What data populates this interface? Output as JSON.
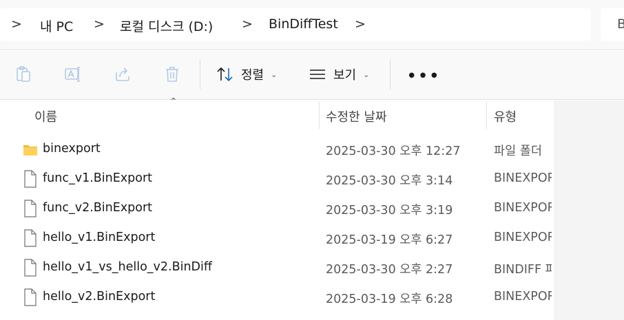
{
  "address_bar": {
    "crumbs": [
      "내 PC",
      "로컬 디스크 (D:)",
      "BinDiffTest"
    ],
    "separator": ">",
    "search_partial": "B"
  },
  "toolbar": {
    "actions": [
      {
        "name": "paste",
        "icon": "clipboard-icon"
      },
      {
        "name": "rename",
        "icon": "rename-icon"
      },
      {
        "name": "share",
        "icon": "share-icon"
      },
      {
        "name": "delete",
        "icon": "trash-icon"
      }
    ],
    "sort_label": "정렬",
    "view_label": "보기",
    "more_label": "•••"
  },
  "columns": {
    "name": "이름",
    "modified": "수정한 날짜",
    "type": "유형"
  },
  "files": [
    {
      "name": "binexport",
      "modified": "2025-03-30 오후 12:27",
      "type": "파일 폴더",
      "icon": "folder-icon"
    },
    {
      "name": "func_v1.BinExport",
      "modified": "2025-03-30 오후 3:14",
      "type": "BINEXPORT",
      "icon": "file-icon"
    },
    {
      "name": "func_v2.BinExport",
      "modified": "2025-03-30 오후 3:19",
      "type": "BINEXPORT",
      "icon": "file-icon"
    },
    {
      "name": "hello_v1.BinExport",
      "modified": "2025-03-19 오후 6:27",
      "type": "BINEXPORT",
      "icon": "file-icon"
    },
    {
      "name": "hello_v1_vs_hello_v2.BinDiff",
      "modified": "2025-03-30 오후 2:27",
      "type": "BINDIFF 파",
      "icon": "file-icon"
    },
    {
      "name": "hello_v2.BinExport",
      "modified": "2025-03-19 오후 6:28",
      "type": "BINEXPORT",
      "icon": "file-icon"
    }
  ]
}
